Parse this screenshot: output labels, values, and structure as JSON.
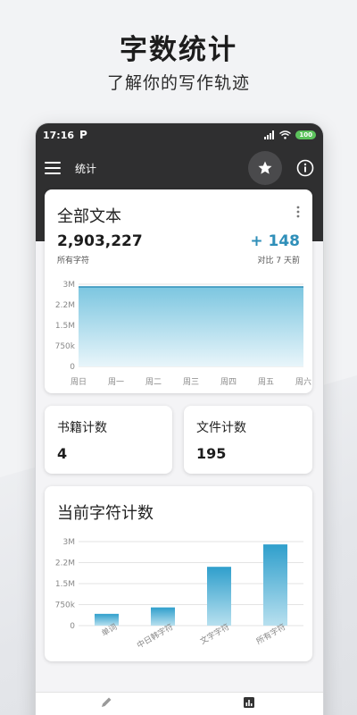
{
  "promo": {
    "title": "字数统计",
    "subtitle": "了解你的写作轨迹"
  },
  "status_bar": {
    "time": "17:16",
    "notification": "P",
    "battery": "100"
  },
  "toolbar": {
    "title": "统计",
    "star_icon": "star-icon",
    "info_icon": "info-icon"
  },
  "all_text": {
    "title": "全部文本",
    "total": "2,903,227",
    "total_label": "所有字符",
    "delta": "+ 148",
    "delta_label": "对比 7 天前"
  },
  "books": {
    "title": "书籍计数",
    "value": "4"
  },
  "files": {
    "title": "文件计数",
    "value": "195"
  },
  "current": {
    "title": "当前字符计数"
  },
  "colors": {
    "accent": "#2f8fb9",
    "area_top": "#7cc6e0",
    "bar": "#3fa8d0",
    "dark": "#2f2f30"
  },
  "chart_data": [
    {
      "type": "area",
      "categories": [
        "周日",
        "周一",
        "周二",
        "周三",
        "周四",
        "周五",
        "周六"
      ],
      "values": [
        2903079,
        2903079,
        2903079,
        2903100,
        2903150,
        2903200,
        2903227
      ],
      "ytick_labels": [
        "0",
        "750k",
        "1.5M",
        "2.2M",
        "3M"
      ],
      "yticks": [
        0,
        750000,
        1500000,
        2250000,
        3000000
      ],
      "ylim": [
        0,
        3000000
      ],
      "grid": true
    },
    {
      "type": "bar",
      "categories": [
        "单词",
        "中日韩字符",
        "文字字符",
        "所有字符"
      ],
      "values": [
        420000,
        650000,
        2100000,
        2900000
      ],
      "ytick_labels": [
        "0",
        "750k",
        "1.5M",
        "2.2M",
        "3M"
      ],
      "yticks": [
        0,
        750000,
        1500000,
        2250000,
        3000000
      ],
      "ylim": [
        0,
        3000000
      ],
      "grid": true
    }
  ]
}
